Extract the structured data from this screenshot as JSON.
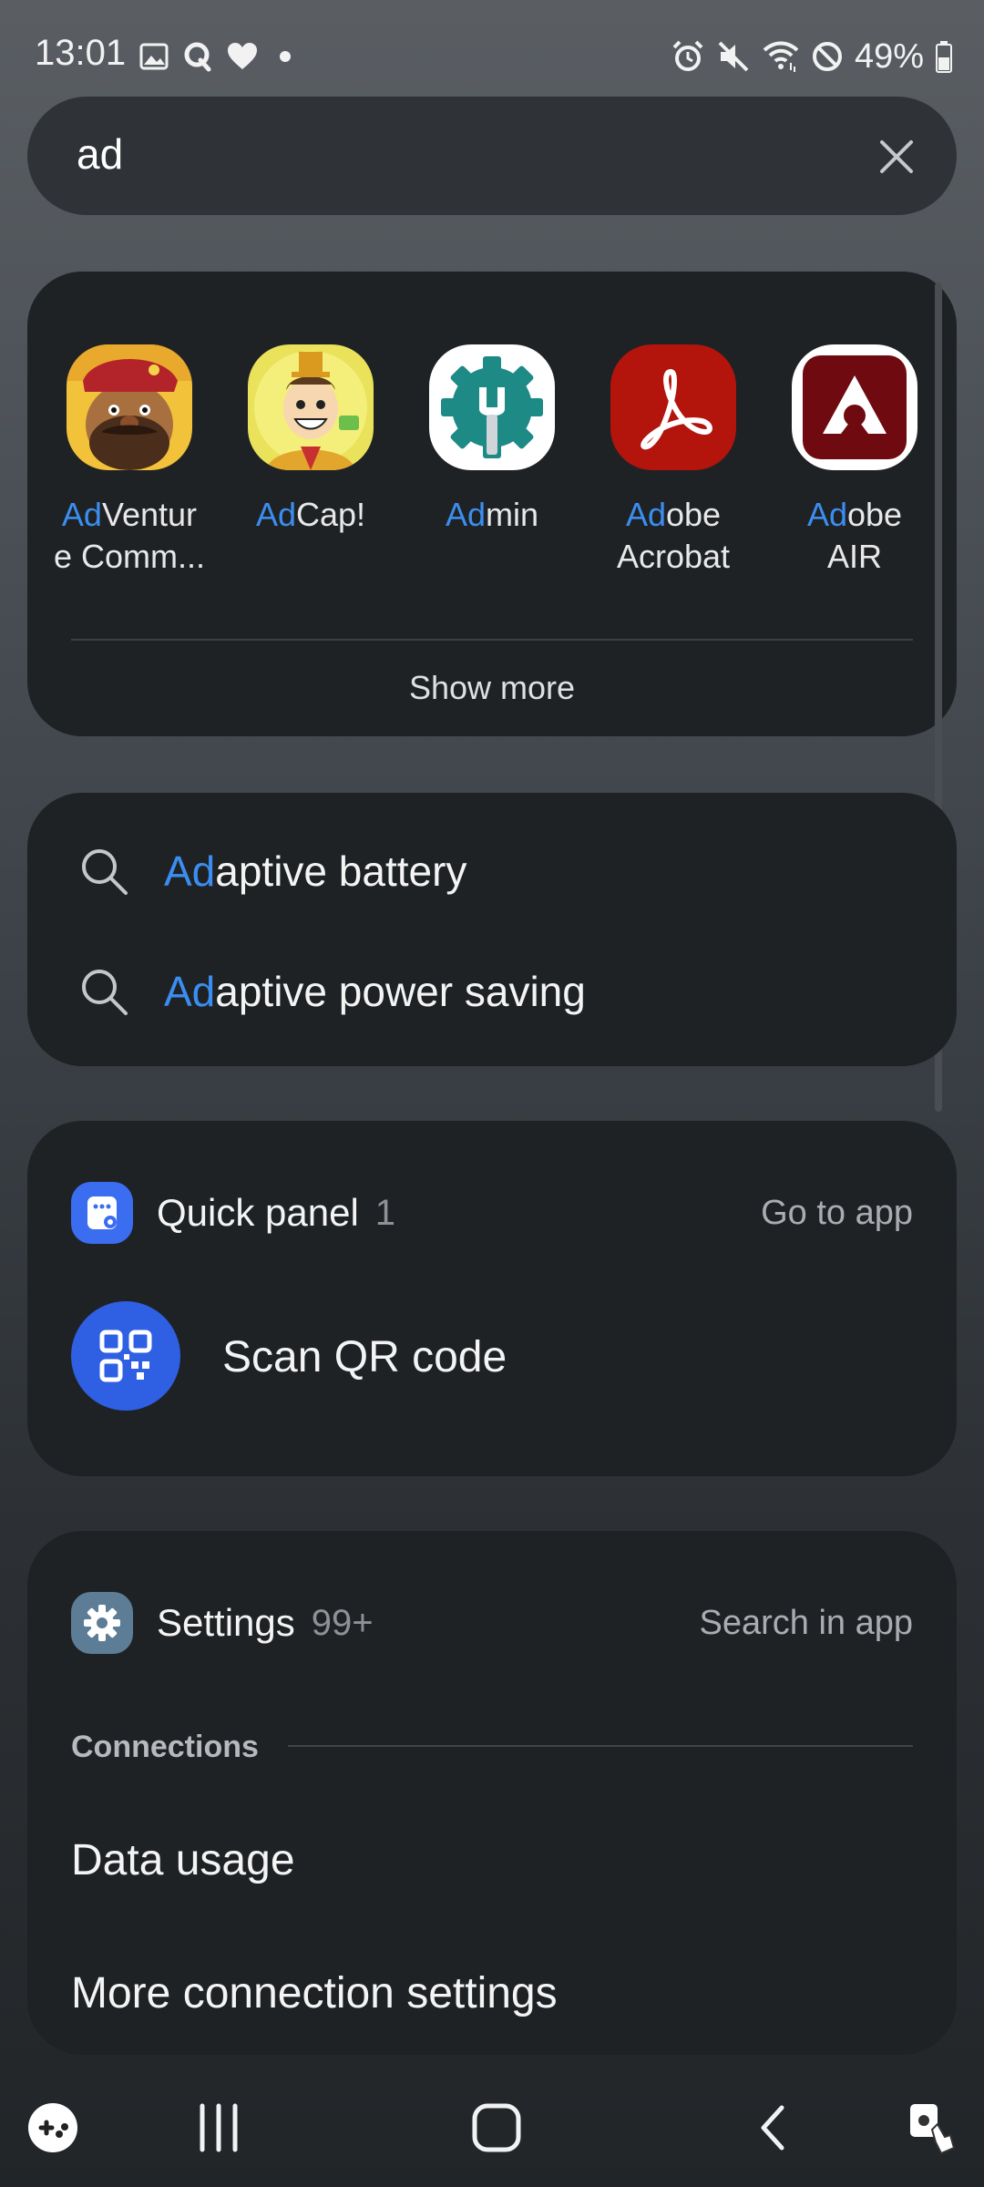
{
  "status_bar": {
    "time": "13:01",
    "battery": "49%",
    "left_icons": [
      "gallery-icon",
      "q-icon",
      "heart-icon",
      "dot-icon"
    ],
    "right_icons": [
      "alarm-icon",
      "mute-icon",
      "wifi-icon",
      "no-disturb-icon",
      "battery-icon"
    ]
  },
  "search": {
    "query": "ad",
    "clear_icon": "close-icon"
  },
  "apps": {
    "items": [
      {
        "highlight": "Ad",
        "rest_line1": "Ventur",
        "line2": "e Comm...",
        "icon": "adventure-communist-icon"
      },
      {
        "highlight": "Ad",
        "rest_line1": "Cap!",
        "line2": "",
        "icon": "adcap-icon"
      },
      {
        "highlight": "Ad",
        "rest_line1": "min",
        "line2": "",
        "icon": "admin-icon"
      },
      {
        "highlight": "Ad",
        "rest_line1": "obe",
        "line2": "Acrobat",
        "icon": "adobe-acrobat-icon"
      },
      {
        "highlight": "Ad",
        "rest_line1": "obe",
        "line2": "AIR",
        "icon": "adobe-air-icon"
      }
    ],
    "show_more": "Show more"
  },
  "suggestions": [
    {
      "highlight": "Ad",
      "rest": "aptive battery"
    },
    {
      "highlight": "Ad",
      "rest": "aptive power saving"
    }
  ],
  "quick_panel": {
    "title": "Quick panel",
    "count": "1",
    "action": "Go to app",
    "item_label": "Scan QR code"
  },
  "settings": {
    "title": "Settings",
    "count": "99+",
    "action": "Search in app",
    "category": "Connections",
    "items": [
      "Data usage",
      "More connection settings"
    ]
  },
  "colors": {
    "highlight": "#3b8ef0",
    "card": "#1f2225",
    "qr_blue": "#2f5fe3"
  }
}
